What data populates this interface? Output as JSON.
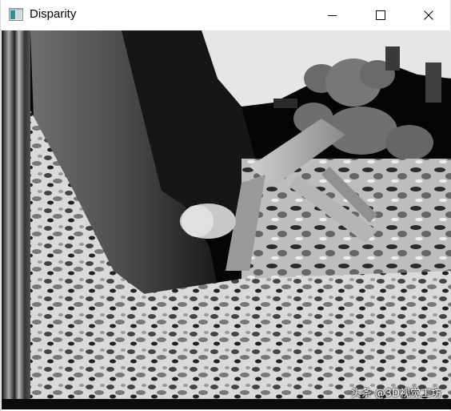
{
  "window": {
    "title": "Disparity",
    "icon": "opencv-window-icon",
    "controls": {
      "minimize": "minimize-icon",
      "maximize": "maximize-icon",
      "close": "close-icon"
    }
  },
  "image": {
    "kind": "disparity-map",
    "watermark": "头条 @3D视觉工坊"
  },
  "colors": {
    "titlebar_bg": "#ffffff",
    "title_text": "#000000",
    "canvas_bg": "#000000"
  }
}
